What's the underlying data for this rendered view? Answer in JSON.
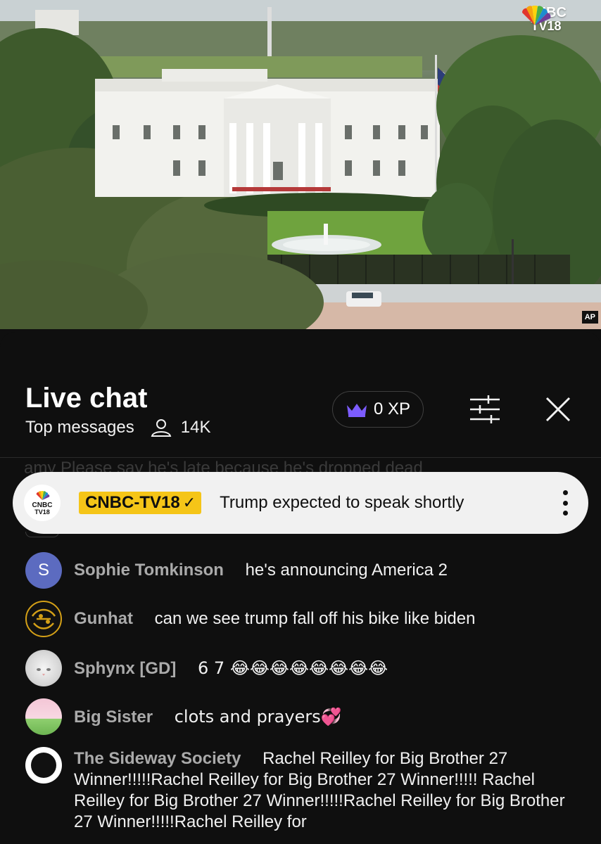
{
  "video": {
    "channel_logo_brand": "CNBC",
    "channel_logo_sub": "TV18",
    "corner_badge": "AP"
  },
  "chat": {
    "title": "Live chat",
    "mode": "Top messages",
    "viewer_count": "14K",
    "xp_label": "0 XP",
    "icons": {
      "viewers": "person-outline-icon",
      "xp": "crown-icon",
      "filter": "sliders-icon",
      "close": "close-icon",
      "more": "more-vert-icon"
    },
    "ghost_message": "amy   Please say he's late because he's dropped dead",
    "pinned": {
      "avatar_brand": "CNBC",
      "avatar_sub": "TV18",
      "author": "CNBC-TV18",
      "verified_mark": "✓",
      "text": "Trump expected to speak shortly",
      "tag_color": "#f5c518"
    },
    "messages": [
      {
        "avatar_letter": "S",
        "avatar_color": "#5c6bc0",
        "author": "Sophie Tomkinson",
        "text": "he's announcing America 2"
      },
      {
        "author": "Gunhat",
        "text": "can we see trump fall off his bike like biden"
      },
      {
        "author": "Sphynx [GD]",
        "text": "6 7 😂😂😂😂😂😂😂😂"
      },
      {
        "author": "Big Sister",
        "text": "clots and prayers💞"
      },
      {
        "author": "The Sideway Society",
        "text": "Rachel Reilley for Big Brother 27 Winner!!!!!Rachel Reilley for Big Brother 27 Winner!!!!! Rachel Reilley for Big Brother 27 Winner!!!!!Rachel Reilley for Big Brother 27 Winner!!!!!Rachel Reilley for"
      }
    ]
  }
}
